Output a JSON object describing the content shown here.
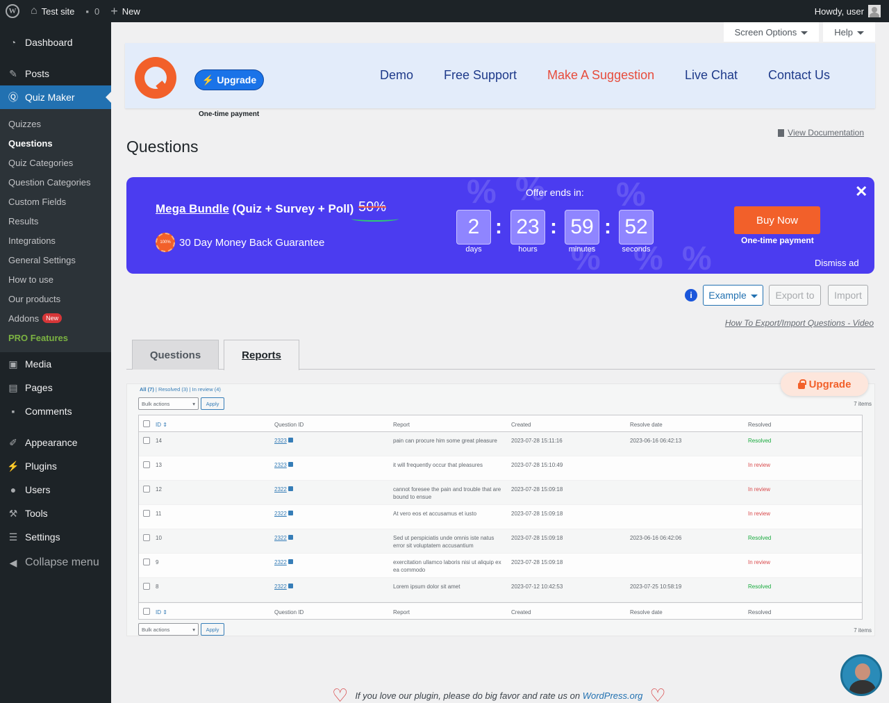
{
  "adminbar": {
    "site_name": "Test site",
    "comments_count": "0",
    "new_label": "New",
    "howdy": "Howdy, user"
  },
  "sidebar": {
    "top_items": [
      {
        "label": "Dashboard",
        "icon": "dashboard-icon"
      },
      {
        "label": "Posts",
        "icon": "pin-icon"
      },
      {
        "label": "Quiz Maker",
        "icon": "quiz-icon"
      }
    ],
    "quiz_submenu": [
      "Quizzes",
      "Questions",
      "Quiz Categories",
      "Question Categories",
      "Custom Fields",
      "Results",
      "Integrations",
      "General Settings",
      "How to use",
      "Our products",
      "Addons",
      "PRO Features"
    ],
    "addons_badge": "New",
    "bottom_items": [
      {
        "label": "Media",
        "icon": "media-icon"
      },
      {
        "label": "Pages",
        "icon": "pages-icon"
      },
      {
        "label": "Comments",
        "icon": "comment-icon"
      },
      {
        "label": "Appearance",
        "icon": "brush-icon"
      },
      {
        "label": "Plugins",
        "icon": "plug-icon"
      },
      {
        "label": "Users",
        "icon": "user-icon"
      },
      {
        "label": "Tools",
        "icon": "wrench-icon"
      },
      {
        "label": "Settings",
        "icon": "sliders-icon"
      },
      {
        "label": "Collapse menu",
        "icon": "collapse-icon"
      }
    ]
  },
  "screen_meta": {
    "screen_options": "Screen Options",
    "help": "Help"
  },
  "header": {
    "upgrade": "Upgrade",
    "one_time": "One-time payment",
    "nav": [
      "Demo",
      "Free Support",
      "Make A Suggestion",
      "Live Chat",
      "Contact Us"
    ]
  },
  "page": {
    "title": "Questions",
    "view_doc": "View Documentation"
  },
  "promo": {
    "title_link": "Mega Bundle",
    "title_rest": "(Quiz + Survey + Poll)",
    "discount": "50%",
    "guarantee": "30 Day Money Back Guarantee",
    "seal_text": "100%",
    "offer_ends": "Offer ends in:",
    "days": "2",
    "days_label": "days",
    "hours": "23",
    "hours_label": "hours",
    "minutes": "59",
    "minutes_label": "minutes",
    "seconds": "52",
    "seconds_label": "seconds",
    "buy_now": "Buy Now",
    "buy_sub": "One-time payment",
    "dismiss": "Dismiss ad",
    "close": "✕"
  },
  "toolbar": {
    "example": "Example",
    "export_to": "Export to",
    "import": "Import",
    "howto": "How To Export/Import Questions - Video"
  },
  "tabs": {
    "questions": "Questions",
    "reports": "Reports"
  },
  "upgrade2": "Upgrade",
  "reports": {
    "filter_all": "All (7)",
    "filter_resolved": "Resolved (3)",
    "filter_review": "In review (4)",
    "bulk_actions": "Bulk actions",
    "apply": "Apply",
    "items": "7 items",
    "columns": [
      "ID",
      "Question ID",
      "Report",
      "Created",
      "Resolve date",
      "Resolved"
    ],
    "rows": [
      {
        "id": "14",
        "qid": "2323",
        "report": "pain can procure him some great pleasure",
        "created": "2023-07-28 15:11:16",
        "resolve": "2023-06-16 06:42:13",
        "status": "Resolved"
      },
      {
        "id": "13",
        "qid": "2323",
        "report": "it will frequently occur that pleasures",
        "created": "2023-07-28 15:10:49",
        "resolve": "",
        "status": "In review"
      },
      {
        "id": "12",
        "qid": "2322",
        "report": "cannot foresee the pain and trouble that are bound to ensue",
        "created": "2023-07-28 15:09:18",
        "resolve": "",
        "status": "In review"
      },
      {
        "id": "11",
        "qid": "2322",
        "report": "At vero eos et accusamus et iusto",
        "created": "2023-07-28 15:09:18",
        "resolve": "",
        "status": "In review"
      },
      {
        "id": "10",
        "qid": "2322",
        "report": "Sed ut perspiciatis unde omnis iste natus error sit voluptatem accusantium",
        "created": "2023-07-28 15:09:18",
        "resolve": "2023-06-16 06:42:06",
        "status": "Resolved"
      },
      {
        "id": "9",
        "qid": "2322",
        "report": "exercitation ullamco laboris nisi ut aliquip ex ea commodo",
        "created": "2023-07-28 15:09:18",
        "resolve": "",
        "status": "In review"
      },
      {
        "id": "8",
        "qid": "2322",
        "report": "Lorem ipsum dolor sit amet",
        "created": "2023-07-12 10:42:53",
        "resolve": "2023-07-25 10:58:19",
        "status": "Resolved"
      }
    ]
  },
  "footer": {
    "text": "If you love our plugin, please do big favor and rate us on",
    "link": "WordPress.org"
  },
  "colors": {
    "accent": "#2271b1",
    "promo": "#4b3cf0",
    "orange": "#f2602a",
    "resolved": "#00a32a",
    "in_review": "#d63638"
  }
}
